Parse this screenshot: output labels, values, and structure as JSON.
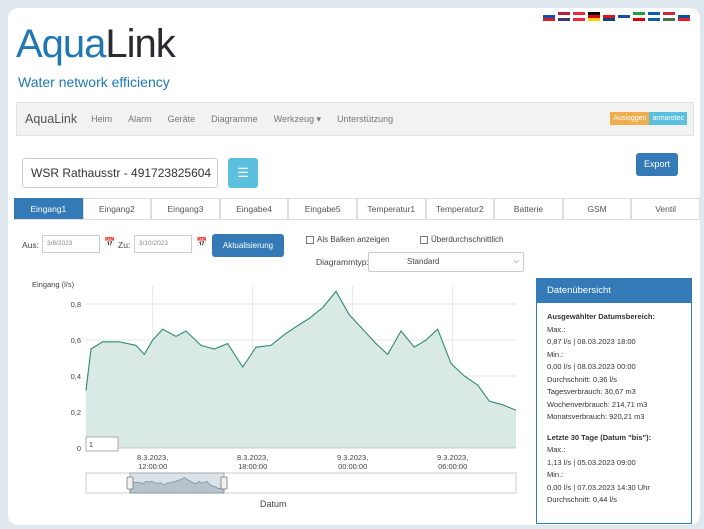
{
  "logo": {
    "part1": "Aqua",
    "part2": "Link"
  },
  "tagline": "Water network efficiency",
  "flags": [
    {
      "c1": "#ffffff",
      "c2": "#1a4ba8",
      "c3": "#d21f26"
    },
    {
      "c1": "#b22234",
      "c2": "#ffffff",
      "c3": "#3c3b6e"
    },
    {
      "c1": "#ed2939",
      "c2": "#ffffff",
      "c3": "#ed2939"
    },
    {
      "c1": "#000000",
      "c2": "#dd0000",
      "c3": "#ffce00"
    },
    {
      "c1": "#ffffff",
      "c2": "#d7141a",
      "c3": "#11457e"
    },
    {
      "c1": "#ffffff",
      "c2": "#1b4ea0",
      "c3": "#ffffff"
    },
    {
      "c1": "#239f40",
      "c2": "#ffffff",
      "c3": "#da0000"
    },
    {
      "c1": "#0d5eaf",
      "c2": "#ffffff",
      "c3": "#0d5eaf"
    },
    {
      "c1": "#ce2939",
      "c2": "#ffffff",
      "c3": "#477050"
    },
    {
      "c1": "#ffffff",
      "c2": "#0b4ea2",
      "c3": "#ee1c25"
    }
  ],
  "navbar": {
    "brand": "AquaLink",
    "items": [
      "Heim",
      "Alarm",
      "Geräte",
      "Diagramme",
      "Werkzeug ▾",
      "Unterstützung"
    ],
    "logout": "Ausloggen",
    "user": "armarotec"
  },
  "station": {
    "name": "WSR Rathausstr - 491723825604"
  },
  "export_label": "Export",
  "tabs": [
    "Eingang1",
    "Eingang2",
    "Eingang3",
    "Eingabe4",
    "Eingabe5",
    "Temperatur1",
    "Temperatur2",
    "Batterie",
    "GSM",
    "Ventil"
  ],
  "active_tab": 0,
  "controls": {
    "from_label": "Aus:",
    "from_value": "3/8/2023",
    "to_label": "Zu:",
    "to_value": "3/10/2023",
    "refresh": "Aktualisierung",
    "bars_label": "Als Balken anzeigen",
    "above_avg_label": "Überdurchschnittlich",
    "charttype_label": "Diagrammtyp:",
    "charttype_value": "Standard"
  },
  "chart_data": {
    "type": "area",
    "ylabel": "Eingang (l/s)",
    "xlabel": "Datum",
    "ylim": [
      0,
      0.9
    ],
    "yticks": [
      "0",
      "0,2",
      "0,4",
      "0,6",
      "0,8"
    ],
    "xticks": [
      "8.3.2023,\n12:00:00",
      "8.3.2023,\n18:00:00",
      "9.3.2023,\n00:00:00",
      "9.3.2023,\n06:00:00"
    ],
    "xtick_hours": [
      12,
      18,
      24,
      30
    ],
    "x_hours": [
      8.0,
      8.3,
      9.0,
      10.0,
      11.0,
      11.5,
      12.0,
      12.6,
      13.4,
      14.0,
      14.9,
      15.7,
      16.5,
      17.4,
      18.2,
      19.1,
      19.9,
      20.7,
      21.4,
      22.2,
      23.0,
      23.8,
      24.6,
      25.4,
      26.1,
      26.9,
      27.7,
      28.4,
      29.1,
      29.9,
      30.7,
      31.5,
      32.2,
      33.0,
      33.8
    ],
    "values": [
      0.32,
      0.55,
      0.59,
      0.59,
      0.57,
      0.52,
      0.6,
      0.66,
      0.62,
      0.65,
      0.57,
      0.55,
      0.58,
      0.45,
      0.56,
      0.57,
      0.63,
      0.68,
      0.72,
      0.78,
      0.87,
      0.74,
      0.66,
      0.58,
      0.52,
      0.65,
      0.56,
      0.6,
      0.66,
      0.47,
      0.4,
      0.35,
      0.26,
      0.24,
      0.21,
      0.2
    ],
    "value_note": "",
    "series_color": "#2e8b6e",
    "fill_color": "#d9e9e5",
    "grid": true,
    "tooltip_value": "1",
    "navigator": true
  },
  "panel": {
    "title": "Datenübersicht",
    "sec1_title": "Ausgewählter Datumsbereich:",
    "sec1_lines": [
      "Max.:",
      "0,87 l/s | 08.03.2023 18:00",
      "Min.:",
      "0,00 l/s | 08.03.2023 00:00",
      "Durchschnitt: 0,36 l/s",
      "Tagesverbrauch: 30,67 m3",
      "Wochenverbrauch: 214,71 m3",
      "Monatsverbrauch: 920,21 m3"
    ],
    "sec2_title": "Letzte 30 Tage (Datum \"bis\"):",
    "sec2_lines": [
      "Max.:",
      "1,13 l/s | 05.03.2023 09:00",
      "Min.:",
      "0,00 l/s | 07.03.2023 14:30 Uhr",
      "Durchschnitt: 0,44 l/s"
    ]
  }
}
